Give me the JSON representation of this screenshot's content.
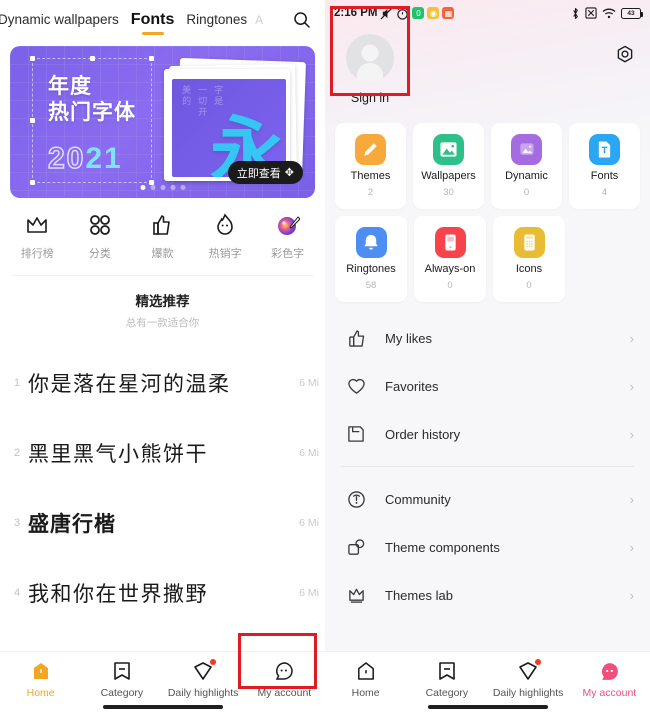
{
  "left_panel": {
    "tabs": [
      {
        "label": "Dynamic wallpapers",
        "state": "partial"
      },
      {
        "label": "Fonts",
        "state": "active"
      },
      {
        "label": "Ringtones",
        "state": "normal"
      },
      {
        "label": "A",
        "state": "faded"
      }
    ],
    "search_icon": "search-icon",
    "banner": {
      "headline_line1": "年度",
      "headline_line2": "热门字体",
      "year_prefix": "20",
      "year_suffix": "21",
      "cta_label": "立即查看",
      "cursor_glyph": "✥",
      "card_text_col1": "美的",
      "card_text_col2": "一切开",
      "card_text_col3": "字是",
      "card_big_char": "永",
      "dots_total": 5,
      "dots_active_index": 0
    },
    "categories": [
      {
        "label": "排行榜",
        "icon": "crown-icon"
      },
      {
        "label": "分类",
        "icon": "grid-icon"
      },
      {
        "label": "爆款",
        "icon": "thumbs-up-icon"
      },
      {
        "label": "热销字",
        "icon": "flame-icon"
      },
      {
        "label": "彩色字",
        "icon": "palette-icon"
      }
    ],
    "section": {
      "title": "精选推荐",
      "subtitle": "总有一款适合你"
    },
    "fonts": [
      {
        "rank": "1",
        "sample": "你是落在星河的温柔",
        "size": "6 Mi"
      },
      {
        "rank": "2",
        "sample": "黑里黑气小熊饼干",
        "size": "6 Mi"
      },
      {
        "rank": "3",
        "sample": "盛唐行楷",
        "size": "6 Mi"
      },
      {
        "rank": "4",
        "sample": "我和你在世界撒野",
        "size": "6 Mi"
      }
    ],
    "bottom_nav": [
      {
        "label": "Home",
        "icon": "home-icon",
        "state": "active"
      },
      {
        "label": "Category",
        "icon": "category-icon",
        "state": "normal"
      },
      {
        "label": "Daily highlights",
        "icon": "diamond-icon",
        "state": "normal",
        "badge": true
      },
      {
        "label": "My account",
        "icon": "account-icon",
        "state": "normal"
      }
    ]
  },
  "right_panel": {
    "status_bar": {
      "time": "2:16 PM",
      "icons_left": [
        "mute-icon",
        "alarm-icon",
        "app-green-icon",
        "app-yellow-icon",
        "app-orange-icon"
      ],
      "icons_right": [
        "bluetooth-icon",
        "no-sim-icon",
        "wifi-icon",
        "battery-icon"
      ],
      "battery_level": "43"
    },
    "profile": {
      "sign_in_label": "Sign in",
      "avatar_icon": "avatar-placeholder-icon",
      "settings_icon": "gear-icon"
    },
    "tiles": [
      [
        {
          "name": "Themes",
          "count": "2",
          "icon": "brush-icon",
          "color": "#f7a93b"
        },
        {
          "name": "Wallpapers",
          "count": "30",
          "icon": "image-icon",
          "color": "#2fc08a"
        },
        {
          "name": "Dynamic",
          "count": "0",
          "icon": "dynamic-image-icon",
          "color": "#a56be0"
        },
        {
          "name": "Fonts",
          "count": "4",
          "icon": "font-doc-icon",
          "color": "#2aa6f2"
        }
      ],
      [
        {
          "name": "Ringtones",
          "count": "58",
          "icon": "bell-icon",
          "color": "#4d8ef0"
        },
        {
          "name": "Always-on",
          "count": "0",
          "icon": "phone-icon",
          "color": "#f8434a"
        },
        {
          "name": "Icons",
          "count": "0",
          "icon": "icon-grid-icon",
          "color": "#e9bd33"
        }
      ]
    ],
    "menu_group_1": [
      {
        "label": "My likes",
        "icon": "thumbs-up-icon"
      },
      {
        "label": "Favorites",
        "icon": "heart-icon"
      },
      {
        "label": "Order history",
        "icon": "save-icon"
      }
    ],
    "menu_group_2": [
      {
        "label": "Community",
        "icon": "community-icon"
      },
      {
        "label": "Theme components",
        "icon": "components-icon"
      },
      {
        "label": "Themes lab",
        "icon": "crown-icon"
      }
    ],
    "chevron": "›",
    "bottom_nav": [
      {
        "label": "Home",
        "icon": "home-icon",
        "state": "normal"
      },
      {
        "label": "Category",
        "icon": "category-icon",
        "state": "normal"
      },
      {
        "label": "Daily highlights",
        "icon": "diamond-icon",
        "state": "normal",
        "badge": true
      },
      {
        "label": "My account",
        "icon": "account-icon",
        "state": "active"
      }
    ]
  },
  "annotations": {
    "accent_red": "#e01b22",
    "accent_orange": "#f5a623",
    "accent_pink": "#ef4e7e"
  }
}
